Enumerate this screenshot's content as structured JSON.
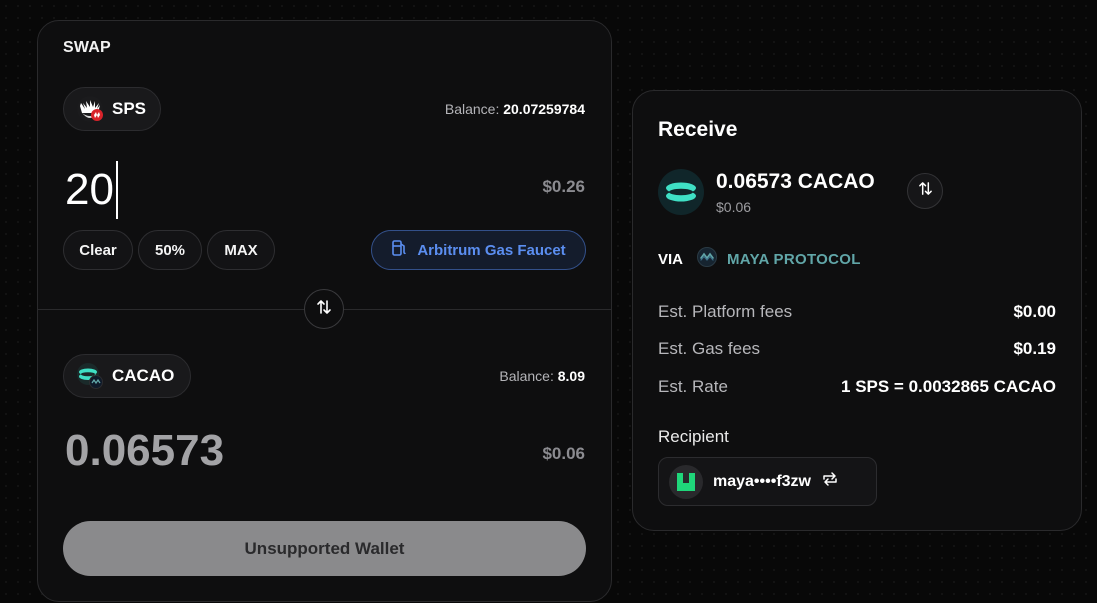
{
  "swap": {
    "title": "SWAP",
    "from": {
      "token": "SPS",
      "balance_label": "Balance:",
      "balance_value": "20.07259784",
      "amount": "20",
      "usd_value": "$0.26"
    },
    "actions": {
      "clear_label": "Clear",
      "half_label": "50%",
      "max_label": "MAX",
      "faucet_label": "Arbitrum Gas Faucet"
    },
    "to": {
      "token": "CACAO",
      "balance_label": "Balance:",
      "balance_value": "8.09",
      "amount": "0.06573",
      "usd_value": "$0.06"
    },
    "submit_label": "Unsupported Wallet"
  },
  "receive": {
    "title": "Receive",
    "amount": "0.06573 CACAO",
    "usd_value": "$0.06",
    "via_label": "VIA",
    "via_name": "MAYA PROTOCOL",
    "fees": [
      {
        "label": "Est. Platform fees",
        "value": "$0.00"
      },
      {
        "label": "Est. Gas fees",
        "value": "$0.19"
      },
      {
        "label": "Est. Rate",
        "value": "1 SPS = 0.0032865 CACAO"
      }
    ],
    "recipient_label": "Recipient",
    "recipient_address": "maya••••f3zw"
  },
  "colors": {
    "accent_blue": "#5b8ef0",
    "maya_teal": "#61a6a8",
    "cacao_cyan": "#3fe0c5",
    "panel_bg": "#0e0e0f"
  },
  "icons": {
    "sps_token": "sps-token-icon",
    "cacao_token": "cacao-token-icon",
    "gas_pump": "gas-pump-icon",
    "flip": "swap-arrows-icon",
    "maya": "maya-logo-icon",
    "refresh": "refresh-icon"
  }
}
